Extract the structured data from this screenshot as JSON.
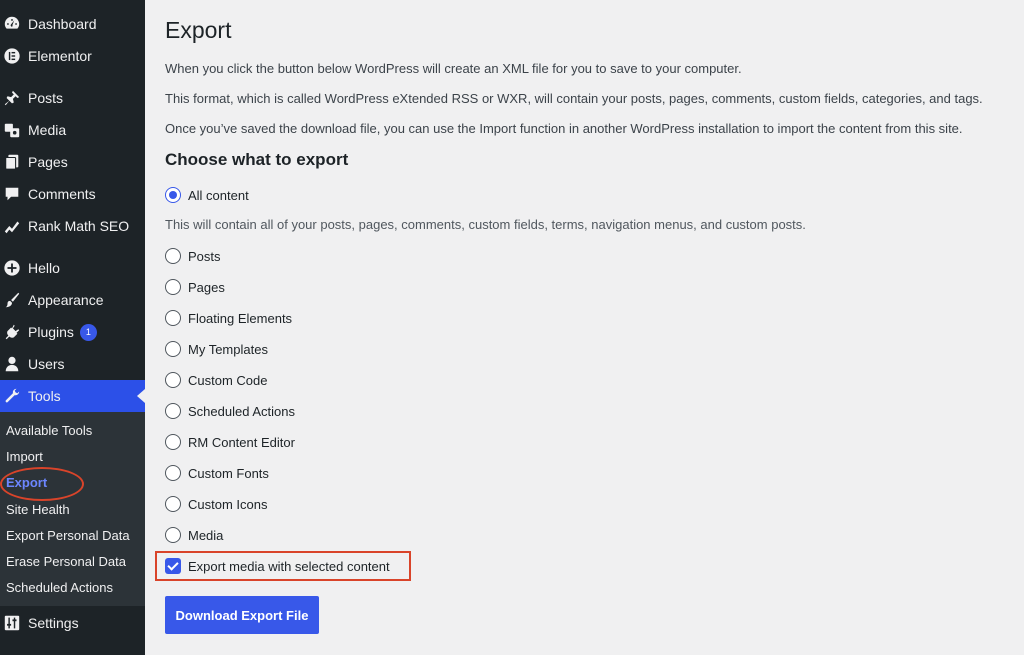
{
  "sidebar": {
    "items": [
      {
        "label": "Dashboard",
        "icon": "dashboard-icon"
      },
      {
        "label": "Elementor",
        "icon": "elementor-icon"
      },
      {
        "label": "Posts",
        "icon": "pin-icon"
      },
      {
        "label": "Media",
        "icon": "media-icon"
      },
      {
        "label": "Pages",
        "icon": "pages-icon"
      },
      {
        "label": "Comments",
        "icon": "comment-icon"
      },
      {
        "label": "Rank Math SEO",
        "icon": "chart-icon"
      },
      {
        "label": "Hello",
        "icon": "plus-circle-icon"
      },
      {
        "label": "Appearance",
        "icon": "brush-icon"
      },
      {
        "label": "Plugins",
        "icon": "plug-icon",
        "badge": "1"
      },
      {
        "label": "Users",
        "icon": "user-icon"
      },
      {
        "label": "Tools",
        "icon": "wrench-icon"
      },
      {
        "label": "Settings",
        "icon": "sliders-icon"
      }
    ],
    "tools_submenu": [
      "Available Tools",
      "Import",
      "Export",
      "Site Health",
      "Export Personal Data",
      "Erase Personal Data",
      "Scheduled Actions"
    ],
    "active_item": "Tools",
    "current_submenu": "Export"
  },
  "main": {
    "title": "Export",
    "intro": [
      "When you click the button below WordPress will create an XML file for you to save to your computer.",
      "This format, which is called WordPress eXtended RSS or WXR, will contain your posts, pages, comments, custom fields, categories, and tags.",
      "Once you’ve saved the download file, you can use the Import function in another WordPress installation to import the content from this site."
    ],
    "section_title": "Choose what to export",
    "all_content_label": "All content",
    "all_content_description": "This will contain all of your posts, pages, comments, custom fields, terms, navigation menus, and custom posts.",
    "options": [
      "Posts",
      "Pages",
      "Floating Elements",
      "My Templates",
      "Custom Code",
      "Scheduled Actions",
      "RM Content Editor",
      "Custom Fonts",
      "Custom Icons",
      "Media"
    ],
    "selected_option": "All content",
    "export_media_label": "Export media with selected content",
    "export_media_checked": true,
    "download_button": "Download Export File"
  },
  "colors": {
    "sidebar_bg": "#1d2327",
    "submenu_bg": "#2c3338",
    "accent": "#3858e9",
    "highlight_annotation": "#d9442a",
    "page_bg": "#f0f0f1"
  }
}
